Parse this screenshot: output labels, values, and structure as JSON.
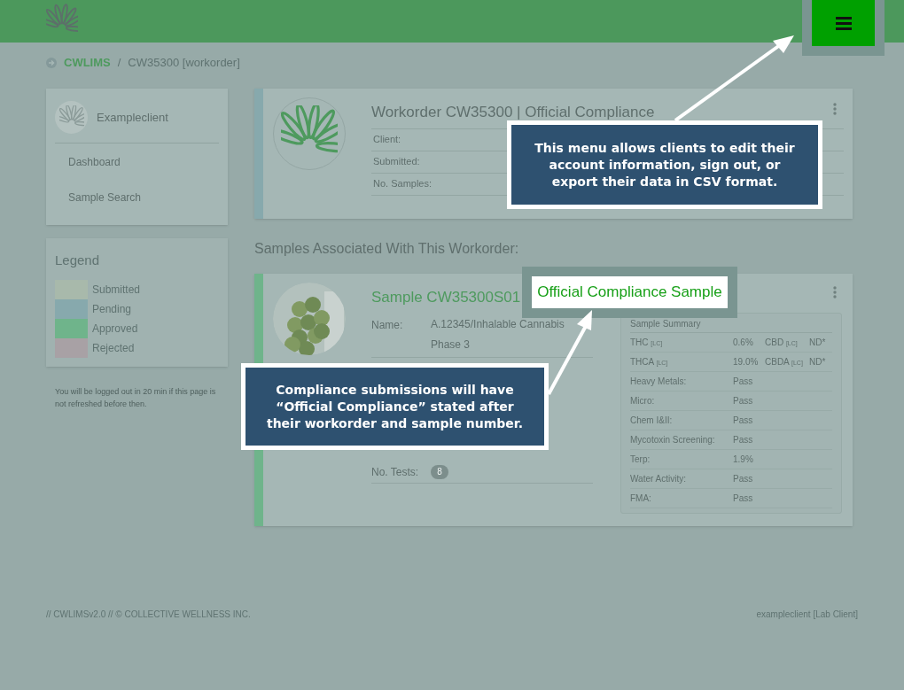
{
  "breadcrumb": [
    {
      "label": "CWLIMS",
      "kind": "link"
    },
    {
      "label": "/",
      "kind": "separator"
    },
    {
      "label": "CW35300 [workorder]",
      "kind": "current"
    }
  ],
  "sidebar": {
    "client_name": "Exampleclient",
    "items": [
      {
        "label": "Dashboard"
      },
      {
        "label": "Sample Search"
      }
    ]
  },
  "legend": {
    "title": "Legend",
    "items": [
      {
        "label": "Submitted",
        "color": "#a8b9ab"
      },
      {
        "label": "Pending",
        "color": "#87a9ad"
      },
      {
        "label": "Approved",
        "color": "#6fb48b"
      },
      {
        "label": "Rejected",
        "color": "#a8a1a5"
      }
    ]
  },
  "session_note": "You will be logged out in 20 min if this page is not refreshed before then.",
  "workorder": {
    "title": "Workorder CW35300 | Official Compliance",
    "color": "#87a9ad",
    "fields": [
      {
        "label": "Client:"
      },
      {
        "label": "Submitted:"
      },
      {
        "label": "No. Samples:"
      }
    ]
  },
  "samples_heading": "Samples Associated With This Workorder:",
  "sample": {
    "title": "Sample CW35300S01",
    "badge": "Official Compliance Sample",
    "color": "#6fb48b",
    "fields": [
      {
        "label": "Name:",
        "value": "A.12345/Inhalable Cannabis Phase 3"
      }
    ],
    "tests_label": "No. Tests:",
    "tests_count": "8",
    "summary": {
      "title": "Sample Summary",
      "rows": [
        {
          "kind": "potency",
          "label": "THC",
          "tag": "[LC]",
          "value": "0.6%",
          "label2": "CBD",
          "tag2": "[LC]",
          "value2": "ND*"
        },
        {
          "kind": "potency",
          "label": "THCA",
          "tag": "[LC]",
          "value": "19.0%",
          "label2": "CBDA",
          "tag2": "[LC]",
          "value2": "ND*"
        },
        {
          "kind": "result",
          "label": "Heavy Metals:",
          "value": "Pass"
        },
        {
          "kind": "result",
          "label": "Micro:",
          "value": "Pass"
        },
        {
          "kind": "result",
          "label": "Chem I&II:",
          "value": "Pass"
        },
        {
          "kind": "result",
          "label": "Mycotoxin Screening:",
          "value": "Pass"
        },
        {
          "kind": "result",
          "label": "Terp:",
          "value": "1.9%"
        },
        {
          "kind": "result",
          "label": "Water Activity:",
          "value": "Pass"
        },
        {
          "kind": "result",
          "label": "FMA:",
          "value": "Pass"
        }
      ]
    }
  },
  "callouts": [
    {
      "text": "This menu allows clients to edit their account information, sign out, or export their data in CSV format."
    },
    {
      "text": "Compliance submissions will have “Official Compliance” stated after their workorder and sample number."
    }
  ],
  "footer": {
    "left": "// CWLIMSv2.0 // © COLLECTIVE WELLNESS INC.",
    "right": "exampleclient [Lab Client]"
  }
}
